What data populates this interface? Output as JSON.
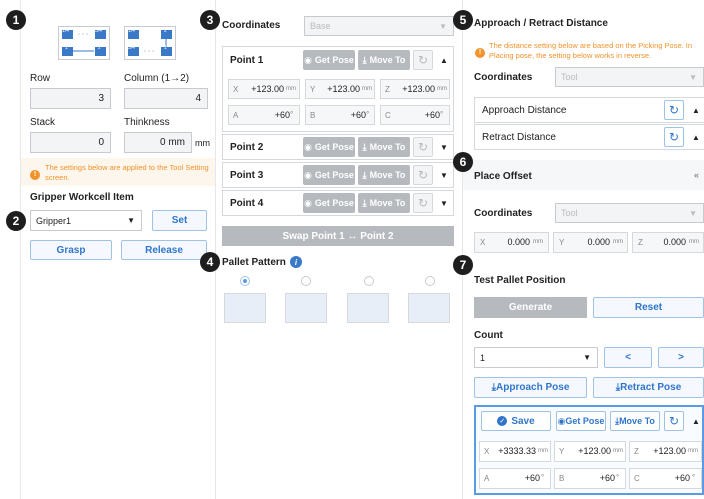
{
  "markers": [
    "1",
    "2",
    "3",
    "4",
    "5",
    "6",
    "7"
  ],
  "left": {
    "diagram_a": {
      "c1": "1/4",
      "c2": "3/4",
      "c3": "1",
      "c4": "2"
    },
    "diagram_b": {
      "c1": "1/4",
      "c2": "2",
      "c3": "3/4",
      "c4": "1"
    },
    "row_label": "Row",
    "column_label": "Column (1→2)",
    "row_value": "3",
    "column_value": "4",
    "stack_label": "Stack",
    "thickness_label": "Thinkness",
    "stack_value": "0",
    "thickness_value": "0 mm",
    "thickness_unit": "mm",
    "warning": "The settings below are applied to the Tool Setting screen.",
    "gripper_title": "Gripper Workcell Item",
    "gripper_select": "Gripper1",
    "set_label": "Set",
    "grasp_label": "Grasp",
    "release_label": "Release"
  },
  "middle": {
    "coordinates_label": "Coordinates",
    "coordinates_value": "Base",
    "point1_label": "Point 1",
    "get_pose_label": "Get Pose",
    "move_to_label": "Move To",
    "p1": {
      "x": "+123.00",
      "y": "+123.00",
      "z": "+123.00",
      "a": "+60",
      "b": "+60",
      "c": "+60",
      "unit": "mm",
      "deg": "°"
    },
    "axis_labels": {
      "x": "X",
      "y": "Y",
      "z": "Z",
      "a": "A",
      "b": "B",
      "c": "C"
    },
    "point2_label": "Point 2",
    "point3_label": "Point 3",
    "point4_label": "Point 4",
    "swap_label": "Swap Point 1 ↔ Point 2",
    "pattern_title": "Pallet Pattern"
  },
  "right": {
    "approach_title": "Approach / Retract Distance",
    "approach_warning": "The distance setting below are based on the Picking Pose. In Placing pose, the setting below works in reverse.",
    "coordinates_label": "Coordinates",
    "coordinates_value": "Tool",
    "approach_distance_label": "Approach Distance",
    "retract_distance_label": "Retract Distance",
    "place_offset_title": "Place Offset",
    "offset_coordinates_label": "Coordinates",
    "offset_coordinates_value": "Tool",
    "offset": {
      "x": "0.000",
      "y": "0.000",
      "z": "0.000",
      "unit": "mm"
    },
    "test_title": "Test Pallet Position",
    "generate_label": "Generate",
    "reset_label": "Reset",
    "count_label": "Count",
    "count_value": "1",
    "prev_label": "<",
    "next_label": ">",
    "approach_pose_label": "Approach Pose",
    "retract_pose_label": "Retract Pose",
    "save_label": "Save",
    "get_pose_label": "Get Pose",
    "move_to_label": "Move To",
    "pose": {
      "x": "+3333.33",
      "y": "+123.00",
      "z": "+123.00",
      "a": "+60",
      "b": "+60",
      "c": "+60",
      "unit": "mm",
      "deg": "°"
    }
  }
}
